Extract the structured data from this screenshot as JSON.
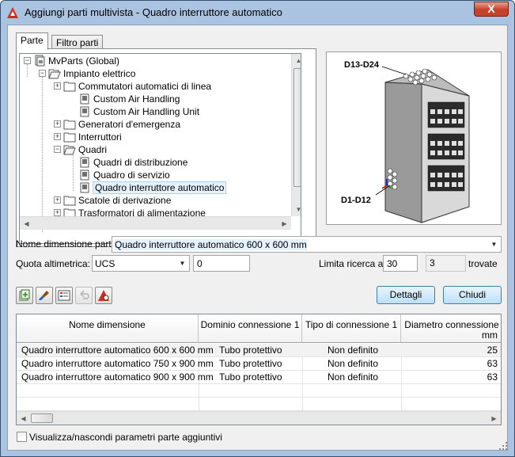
{
  "window": {
    "title": "Aggiungi parti multivista - Quadro interruttore automatico",
    "close_glyph": "X"
  },
  "tabs": [
    {
      "label": "Parte"
    },
    {
      "label": "Filtro parti"
    }
  ],
  "tree": {
    "items": [
      {
        "label": "MvParts (Global)",
        "icon": "catalog-icon",
        "expander": "−"
      },
      {
        "label": "Impianto elettrico",
        "icon": "open-folder-icon",
        "expander": "−"
      },
      {
        "label": "Commutatori automatici di linea",
        "icon": "folder-icon",
        "expander": "+"
      },
      {
        "label": "Custom Air Handling",
        "icon": "part-icon",
        "expander": ""
      },
      {
        "label": "Custom Air Handling Unit",
        "icon": "part-icon",
        "expander": ""
      },
      {
        "label": "Generatori d'emergenza",
        "icon": "folder-icon",
        "expander": "+"
      },
      {
        "label": "Interruttori",
        "icon": "folder-icon",
        "expander": "+"
      },
      {
        "label": "Quadri",
        "icon": "open-folder-icon",
        "expander": "−"
      },
      {
        "label": "Quadri di distribuzione",
        "icon": "part-icon",
        "expander": ""
      },
      {
        "label": "Quadro di servizio",
        "icon": "part-icon",
        "expander": ""
      },
      {
        "label": "Quadro interruttore automatico",
        "icon": "part-icon",
        "expander": "",
        "selected": true
      },
      {
        "label": "Scatole di derivazione",
        "icon": "folder-icon",
        "expander": "+"
      },
      {
        "label": "Trasformatori di alimentazione",
        "icon": "folder-icon",
        "expander": "+"
      }
    ]
  },
  "preview": {
    "label_top": "D13-D24",
    "label_bottom": "D1-D12"
  },
  "form": {
    "dimension_label": "Nome dimensione parte:",
    "dimension_value": "Quadro interruttore automatico 600 x 600 mm",
    "elevation_label": "Quota altimetrica:",
    "elevation_mode": "UCS",
    "elevation_value": "0",
    "limit_label": "Limita ricerca a:",
    "limit_value": "30",
    "found_count": "3",
    "found_label": "trovate"
  },
  "toolbar": {
    "buttons": [
      {
        "name": "add-to-catalog-icon",
        "enabled": true
      },
      {
        "name": "paint-brush-icon",
        "enabled": true
      },
      {
        "name": "properties-list-icon",
        "enabled": true
      },
      {
        "name": "undo-icon",
        "enabled": false
      },
      {
        "name": "part-builder-icon",
        "enabled": true
      }
    ]
  },
  "buttons": {
    "details": "Dettagli",
    "close": "Chiudi"
  },
  "table": {
    "columns": [
      {
        "label": "Nome dimensione"
      },
      {
        "label": "Dominio connessione 1"
      },
      {
        "label": "Tipo di connessione 1"
      },
      {
        "label": "Diametro connessione",
        "sub": "mm"
      }
    ],
    "rows": [
      [
        "Quadro interruttore automatico 600 x 600 mm",
        "Tubo protettivo",
        "Non definito",
        "25"
      ],
      [
        "Quadro interruttore automatico 750 x 900 mm",
        "Tubo protettivo",
        "Non definito",
        "63"
      ],
      [
        "Quadro interruttore automatico 900 x 900 mm",
        "Tubo protettivo",
        "Non definito",
        "63"
      ]
    ]
  },
  "footer": {
    "checkbox_label": "Visualizza/nascondi parametri parte aggiuntivi",
    "checked": false
  },
  "colors": {
    "title_bg": "#a9c3e1",
    "close_red": "#c7452f",
    "button_blue": "#bde0f8",
    "selection": "#e5f1fb"
  }
}
